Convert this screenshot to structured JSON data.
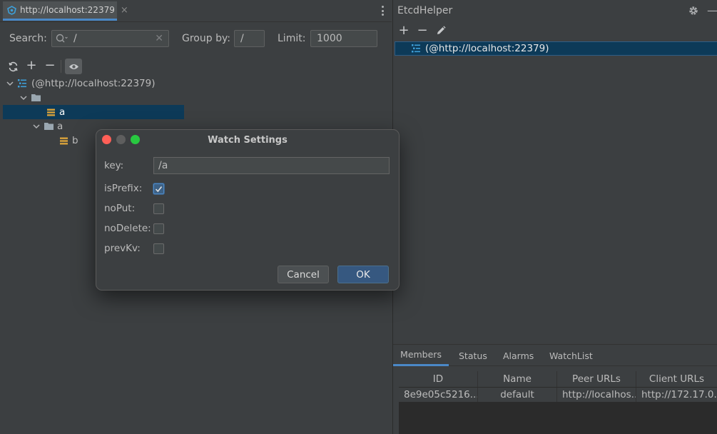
{
  "left": {
    "tab": {
      "label": "http://localhost:22379",
      "close": "×"
    },
    "search": {
      "label": "Search:",
      "value": "/"
    },
    "group_by": {
      "label": "Group by:",
      "value": "/"
    },
    "limit": {
      "label": "Limit:",
      "value": "1000"
    },
    "toolbar": {
      "add": "+",
      "remove": "−"
    },
    "tree": {
      "root": "(@http://localhost:22379)",
      "key_a": "a",
      "folder_a": "a",
      "key_b": "b"
    }
  },
  "right": {
    "title": "EtcdHelper",
    "min": "—",
    "toolbar": {
      "add": "+",
      "remove": "−"
    },
    "connection": "(@http://localhost:22379)",
    "tabs": [
      "Members",
      "Status",
      "Alarms",
      "WatchList"
    ],
    "table": {
      "headers": [
        "ID",
        "Name",
        "Peer URLs",
        "Client URLs"
      ],
      "rows": [
        [
          "8e9e05c5216...",
          "default",
          "http://localhos...",
          "http://172.17.0..."
        ]
      ]
    }
  },
  "dialog": {
    "title": "Watch Settings",
    "key_label": "key:",
    "key_value": "/a",
    "options": [
      {
        "label": "isPrefix:",
        "checked": true
      },
      {
        "label": "noPut:",
        "checked": false
      },
      {
        "label": "noDelete:",
        "checked": false
      },
      {
        "label": "prevKv:",
        "checked": false
      }
    ],
    "cancel": "Cancel",
    "ok": "OK"
  },
  "colors": {
    "background": "#3c3f41",
    "selection": "#0d3a58",
    "accent": "#4a88c7",
    "db_icon": "#3e9fd8",
    "key_icon": "#d9a23a",
    "close_red": "#ff5f57",
    "min_gray": "#5e5e5e",
    "zoom_green": "#28c840"
  }
}
